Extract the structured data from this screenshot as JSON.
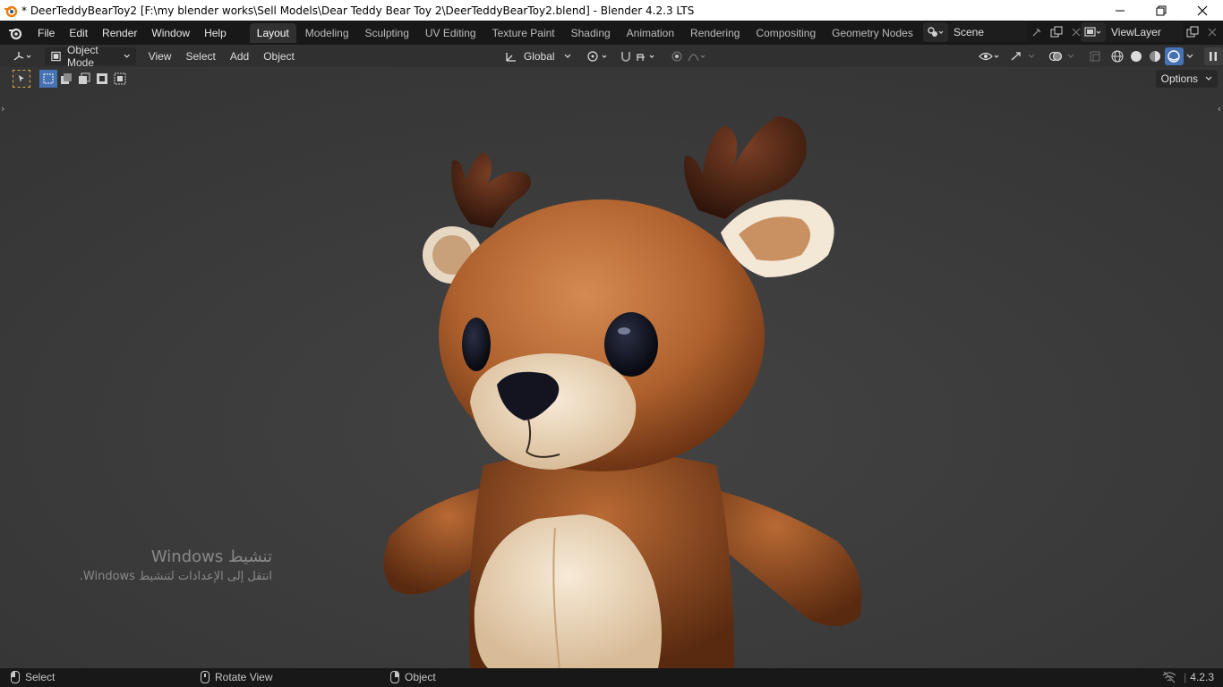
{
  "window": {
    "title": "* DeerTeddyBearToy2 [F:\\my blender works\\Sell Models\\Dear Teddy Bear Toy 2\\DeerTeddyBearToy2.blend] - Blender 4.2.3 LTS",
    "controls": [
      "minimize-icon",
      "restore-icon",
      "close-icon"
    ]
  },
  "menu": {
    "items": [
      "File",
      "Edit",
      "Render",
      "Window",
      "Help"
    ]
  },
  "workspaces": {
    "tabs": [
      "Layout",
      "Modeling",
      "Sculpting",
      "UV Editing",
      "Texture Paint",
      "Shading",
      "Animation",
      "Rendering",
      "Compositing",
      "Geometry Nodes"
    ],
    "active": "Layout"
  },
  "scene": {
    "name": "Scene",
    "view_layer": "ViewLayer"
  },
  "viewport_header": {
    "editor_type_icon": "3d-viewport-icon",
    "mode": "Object Mode",
    "menus": [
      "View",
      "Select",
      "Add",
      "Object"
    ],
    "transform_orientation": "Global",
    "options_label": "Options"
  },
  "watermark": {
    "title": "تنشيط Windows",
    "subtitle": "انتقل إلى الإعدادات لتنشيط Windows."
  },
  "statusbar": {
    "select": "Select",
    "rotate": "Rotate View",
    "object": "Object",
    "version": "4.2.3"
  },
  "colors": {
    "accent": "#4772b3",
    "viewport_bg": "#3d3d3d",
    "topbar_bg": "#181818",
    "header_bg": "#303030"
  }
}
